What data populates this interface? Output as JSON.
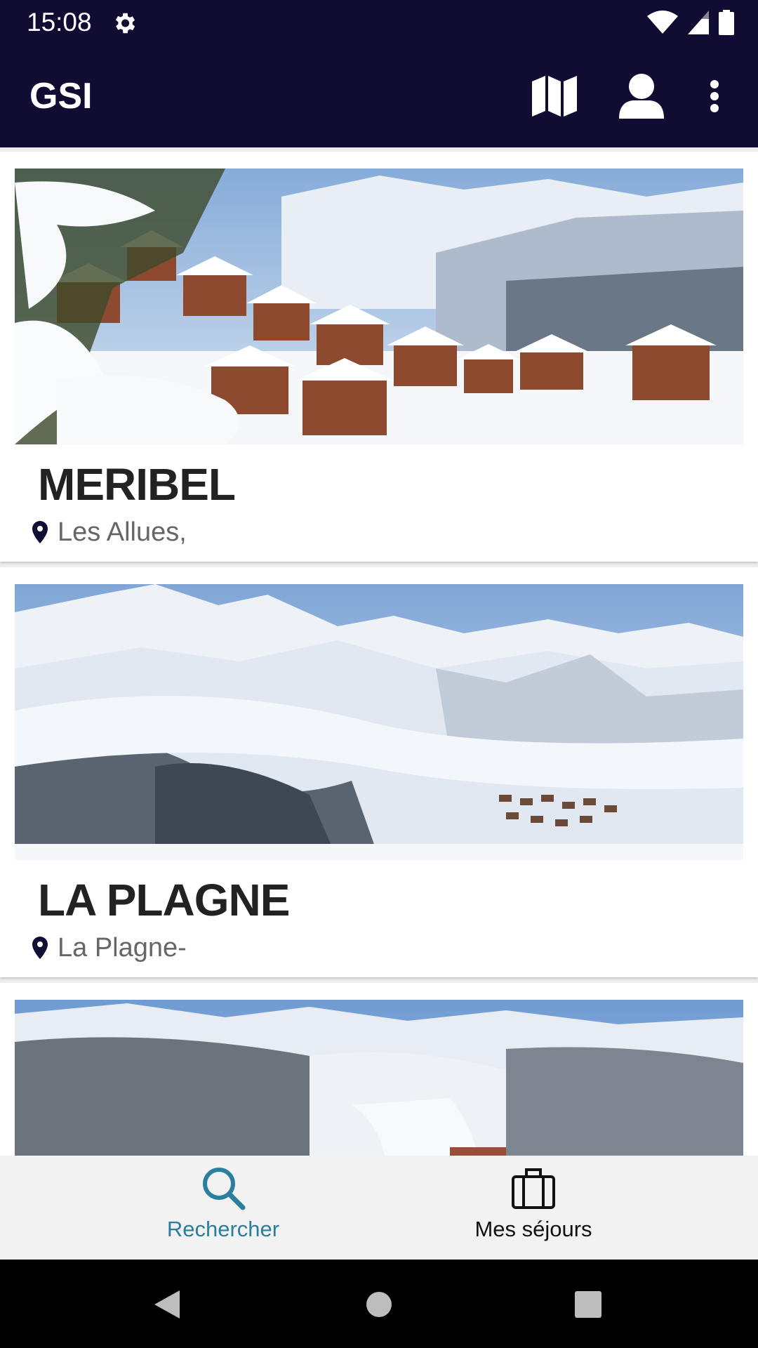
{
  "status_bar": {
    "time": "15:08",
    "icons": [
      "settings-icon",
      "wifi-icon",
      "cell-signal-icon",
      "battery-icon"
    ]
  },
  "app_bar": {
    "title": "GSI",
    "actions": [
      "map-icon",
      "account-icon",
      "overflow-menu-icon"
    ]
  },
  "resorts": [
    {
      "name": "MERIBEL",
      "location": "Les Allues,",
      "image": "snowy chalets village"
    },
    {
      "name": "LA PLAGNE",
      "location": "La Plagne-",
      "image": "snowy mountain panorama"
    },
    {
      "name": "",
      "location": "",
      "image": "snowy forest and ski slopes"
    }
  ],
  "bottom_nav": {
    "items": [
      {
        "label": "Rechercher",
        "icon": "search-icon",
        "active": true
      },
      {
        "label": "Mes séjours",
        "icon": "suitcase-icon",
        "active": false
      }
    ]
  },
  "colors": {
    "app_bar": "#100c32",
    "accent": "#2a7f9e",
    "text": "#222222",
    "secondary_text": "#666666"
  }
}
